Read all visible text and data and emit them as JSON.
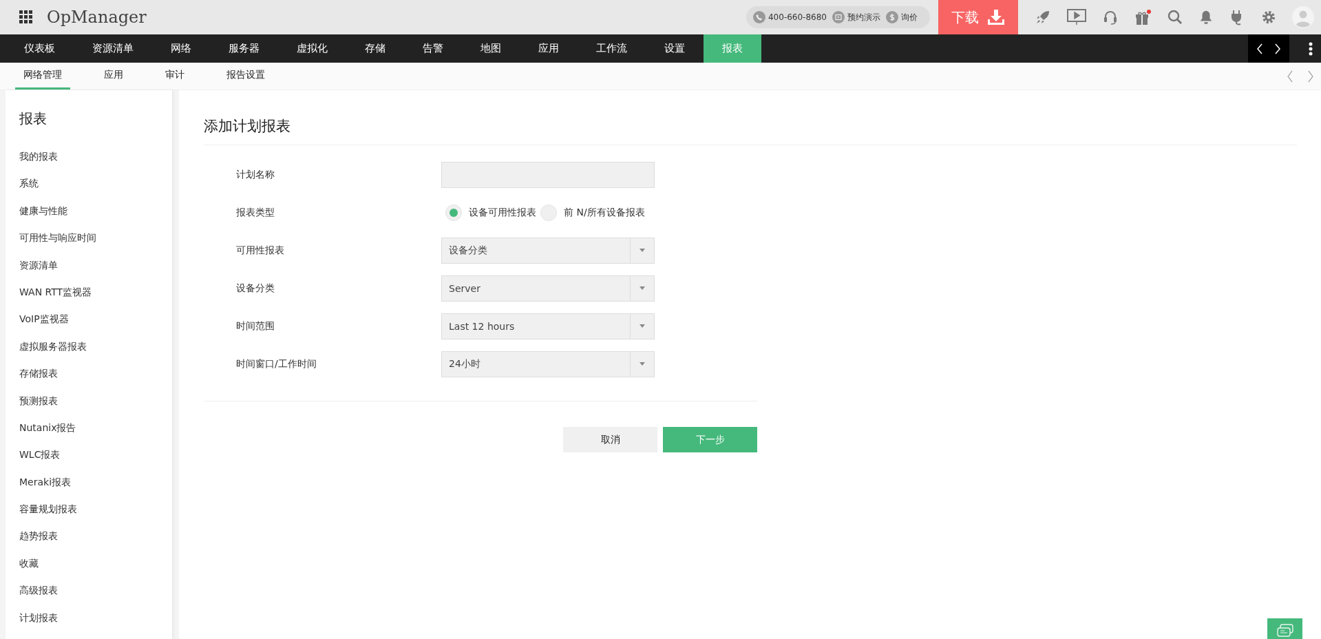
{
  "app": {
    "name": "OpManager"
  },
  "contact": {
    "phone": "400-660-8680",
    "demo": "预约演示",
    "price": "询价"
  },
  "download": {
    "label": "下载"
  },
  "nav": [
    {
      "label": "仪表板",
      "selected": false
    },
    {
      "label": "资源清单",
      "selected": false
    },
    {
      "label": "网络",
      "selected": false
    },
    {
      "label": "服务器",
      "selected": false
    },
    {
      "label": "虚拟化",
      "selected": false
    },
    {
      "label": "存储",
      "selected": false
    },
    {
      "label": "告警",
      "selected": false
    },
    {
      "label": "地图",
      "selected": false
    },
    {
      "label": "应用",
      "selected": false
    },
    {
      "label": "工作流",
      "selected": false
    },
    {
      "label": "设置",
      "selected": false
    },
    {
      "label": "报表",
      "selected": true
    }
  ],
  "subnav": [
    {
      "label": "网络管理",
      "selected": true
    },
    {
      "label": "应用",
      "selected": false
    },
    {
      "label": "审计",
      "selected": false
    },
    {
      "label": "报告设置",
      "selected": false
    }
  ],
  "sidebar": {
    "title": "报表",
    "items": [
      "我的报表",
      "系统",
      "健康与性能",
      "可用性与响应时间",
      "资源清单",
      "WAN RTT监视器",
      "VoIP监视器",
      "虚拟服务器报表",
      "存储报表",
      "预测报表",
      "Nutanix报告",
      "WLC报表",
      "Meraki报表",
      "容量规划报表",
      "趋势报表",
      "收藏",
      "高级报表",
      "计划报表"
    ]
  },
  "form": {
    "title": "添加计划报表",
    "fields": [
      {
        "kind": "text",
        "label": "计划名称"
      },
      {
        "kind": "radio",
        "label": "报表类型",
        "options": [
          {
            "label": "设备可用性报表",
            "selected": true
          },
          {
            "label": "前 N/所有设备报表",
            "selected": false
          }
        ]
      },
      {
        "kind": "select",
        "label": "可用性报表",
        "value": "设备分类"
      },
      {
        "kind": "select",
        "label": "设备分类",
        "value": "Server"
      },
      {
        "kind": "select",
        "label": "时间范围",
        "value": "Last 12 hours"
      },
      {
        "kind": "select",
        "label": "时间窗口/工作时间",
        "value": "24小时"
      }
    ]
  },
  "buttons": [
    {
      "label": "取消",
      "kind": "secondary"
    },
    {
      "label": "下一步",
      "kind": "primary"
    }
  ]
}
